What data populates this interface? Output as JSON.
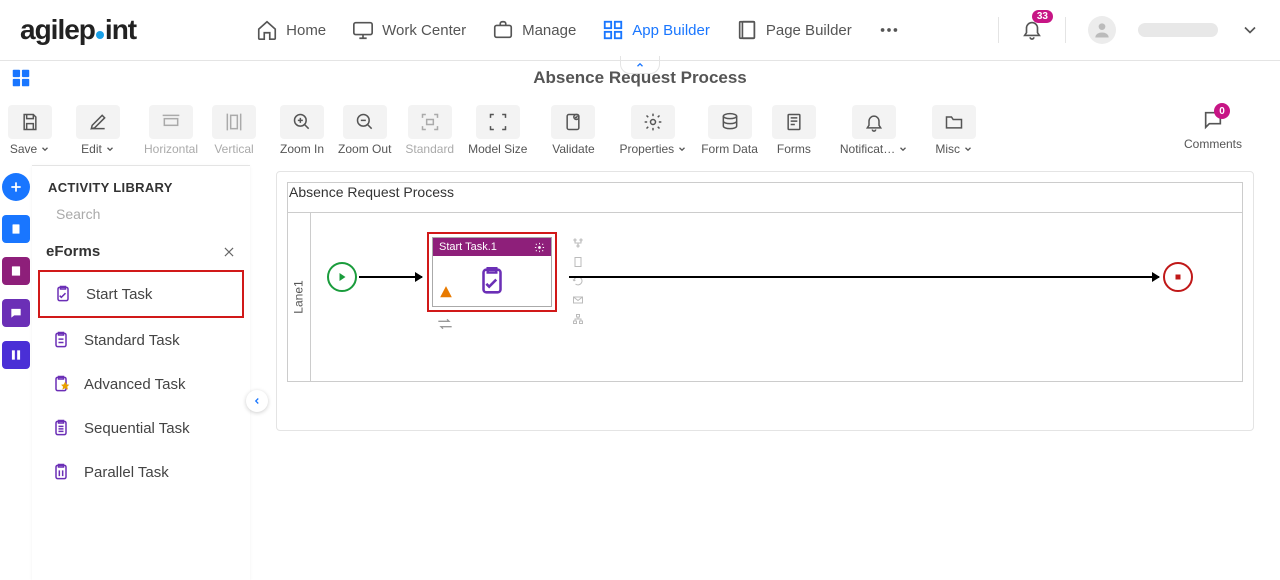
{
  "topnav": {
    "logo_a": "agilep",
    "logo_b": "int",
    "items": [
      {
        "label": "Home"
      },
      {
        "label": "Work Center"
      },
      {
        "label": "Manage"
      },
      {
        "label": "App Builder"
      },
      {
        "label": "Page Builder"
      }
    ],
    "badge": "33"
  },
  "title": "Absence Request Process",
  "toolbar": {
    "save": "Save",
    "edit": "Edit",
    "horizontal": "Horizontal",
    "vertical": "Vertical",
    "zoomin": "Zoom In",
    "zoomout": "Zoom Out",
    "standard": "Standard",
    "modelsize": "Model Size",
    "validate": "Validate",
    "properties": "Properties",
    "formdata": "Form Data",
    "forms": "Forms",
    "notifications": "Notificat…",
    "misc": "Misc",
    "comments": "Comments",
    "comments_count": "0"
  },
  "sidebar": {
    "header": "ACTIVITY LIBRARY",
    "search_placeholder": "Search",
    "category": "eForms",
    "items": [
      {
        "label": "Start Task"
      },
      {
        "label": "Standard Task"
      },
      {
        "label": "Advanced Task"
      },
      {
        "label": "Sequential Task"
      },
      {
        "label": "Parallel Task"
      }
    ]
  },
  "canvas": {
    "title": "Absence Request Process",
    "lane": "Lane1",
    "task": {
      "title": "Start Task.1"
    }
  }
}
